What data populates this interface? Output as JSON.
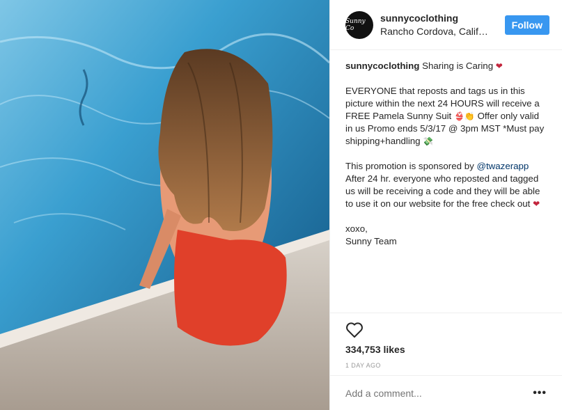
{
  "post": {
    "username": "sunnycoclothing",
    "location": "Rancho Cordova, Califor..",
    "avatar_text": "Sunny Co",
    "follow_label": "Follow",
    "caption": {
      "username": "sunnycoclothing",
      "line1": "Sharing is Caring",
      "p1a": "EVERYONE that reposts and tags us in this picture within the next 24 HOURS will receive a FREE Pamela Sunny Suit",
      "p1b": "Offer only valid in us Promo ends 5/3/17 @ 3pm MST *Must pay shipping+handling",
      "p2a": "This promotion is sponsored by",
      "mention": "@twazerapp",
      "p2b": "After 24 hr. everyone who reposted and tagged us will be receiving a code and they will be able to use it on our website for the free check out",
      "sign1": "xoxo,",
      "sign2": "Sunny Team"
    },
    "likes": "334,753 likes",
    "time_ago": "1 DAY AGO",
    "comment_placeholder": "Add a comment...",
    "more_label": "•••",
    "icons": {
      "heart_emoji": "❤",
      "swimsuit_emoji": "👙",
      "clap_emoji": "👏",
      "money_emoji": "💸"
    },
    "colors": {
      "follow": "#3897f0",
      "mention": "#003569",
      "heart": "#c3263d"
    }
  }
}
